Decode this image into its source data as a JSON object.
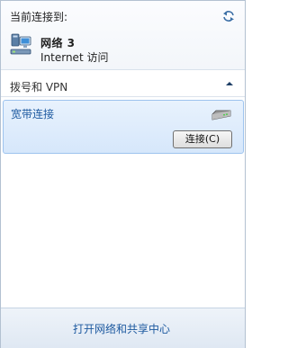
{
  "header": {
    "title": "当前连接到:",
    "refresh_icon": "refresh-icon",
    "network": {
      "name": "网络  3",
      "status": "Internet 访问",
      "icon": "network-icon"
    }
  },
  "section": {
    "label": "拨号和 VPN",
    "toggle_icon": "chevron-up-icon"
  },
  "connection": {
    "name": "宽带连接",
    "icon": "modem-icon",
    "button_label": "连接(C)"
  },
  "footer": {
    "link": "打开网络和共享中心"
  },
  "colors": {
    "link": "#1e5aa0",
    "selection_bg": "#d6e7fb",
    "selection_border": "#9dc3ee"
  }
}
